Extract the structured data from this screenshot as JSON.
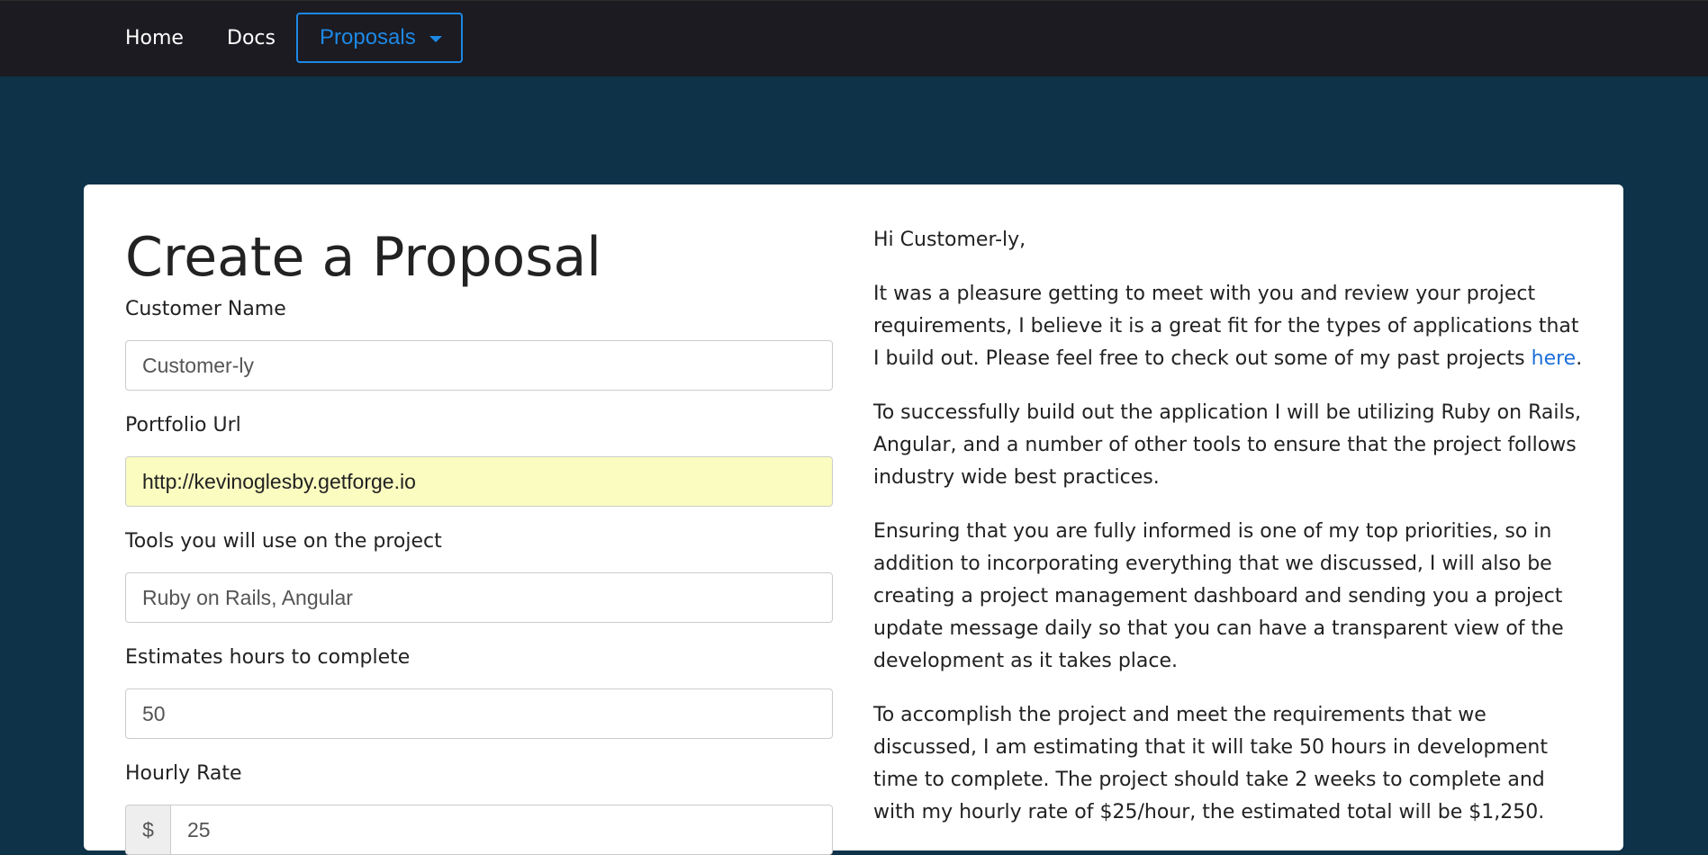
{
  "nav": {
    "home": "Home",
    "docs": "Docs",
    "proposals": "Proposals"
  },
  "form": {
    "title": "Create a Proposal",
    "customer_name": {
      "label": "Customer Name",
      "value": "Customer-ly"
    },
    "portfolio_url": {
      "label": "Portfolio Url",
      "value": "http://kevinoglesby.getforge.io"
    },
    "tools": {
      "label": "Tools you will use on the project",
      "value": "Ruby on Rails, Angular"
    },
    "hours": {
      "label": "Estimates hours to complete",
      "value": "50"
    },
    "rate": {
      "label": "Hourly Rate",
      "currency": "$",
      "value": "25"
    }
  },
  "preview": {
    "greeting": "Hi Customer-ly,",
    "p1_text": "It was a pleasure getting to meet with you and review your project requirements, I believe it is a great fit for the types of applications that I build out. Please feel free to check out some of my past projects ",
    "p1_link": "here",
    "p1_end": ".",
    "p2": "To successfully build out the application I will be utilizing Ruby on Rails, Angular, and a number of other tools to ensure that the project follows industry wide best practices.",
    "p3": "Ensuring that you are fully informed is one of my top priorities, so in addition to incorporating everything that we discussed, I will also be creating a project management dashboard and sending you a project update message daily so that you can have a transparent view of the development as it takes place.",
    "p4": "To accomplish the project and meet the requirements that we discussed, I am estimating that it will take 50 hours in development time to complete. The project should take 2 weeks to complete and with my hourly rate of $25/hour, the estimated total will be $1,250."
  },
  "colors": {
    "navbar": "#1b1b21",
    "background": "#0e3349",
    "accent": "#1e88e5",
    "autofill": "#fafcc0"
  }
}
